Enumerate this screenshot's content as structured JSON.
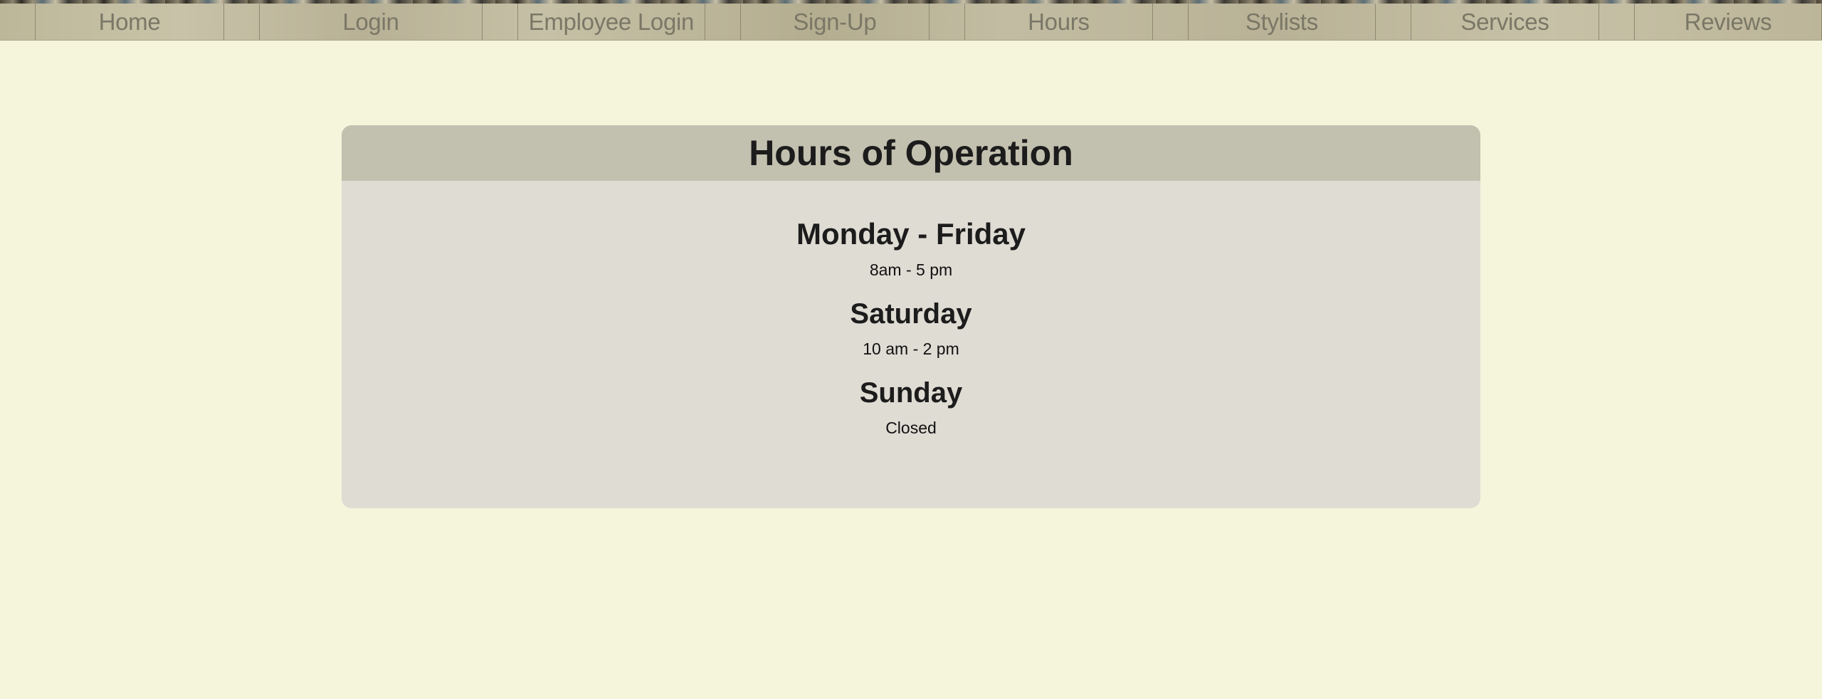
{
  "nav": {
    "items": [
      {
        "label": "Home"
      },
      {
        "label": "Login"
      },
      {
        "label": "Employee Login"
      },
      {
        "label": "Sign-Up"
      },
      {
        "label": "Hours"
      },
      {
        "label": "Stylists"
      },
      {
        "label": "Services"
      },
      {
        "label": "Reviews"
      }
    ]
  },
  "hours": {
    "title": "Hours of Operation",
    "rows": [
      {
        "day": "Monday - Friday",
        "time": "8am - 5 pm"
      },
      {
        "day": "Saturday",
        "time": "10 am - 2 pm"
      },
      {
        "day": "Sunday",
        "time": "Closed"
      }
    ]
  },
  "colors": {
    "page_background": "#f5f5dc",
    "card_background": "#dfdcd4",
    "card_header": "#c2c0ae",
    "nav_text": "#7a7766"
  }
}
